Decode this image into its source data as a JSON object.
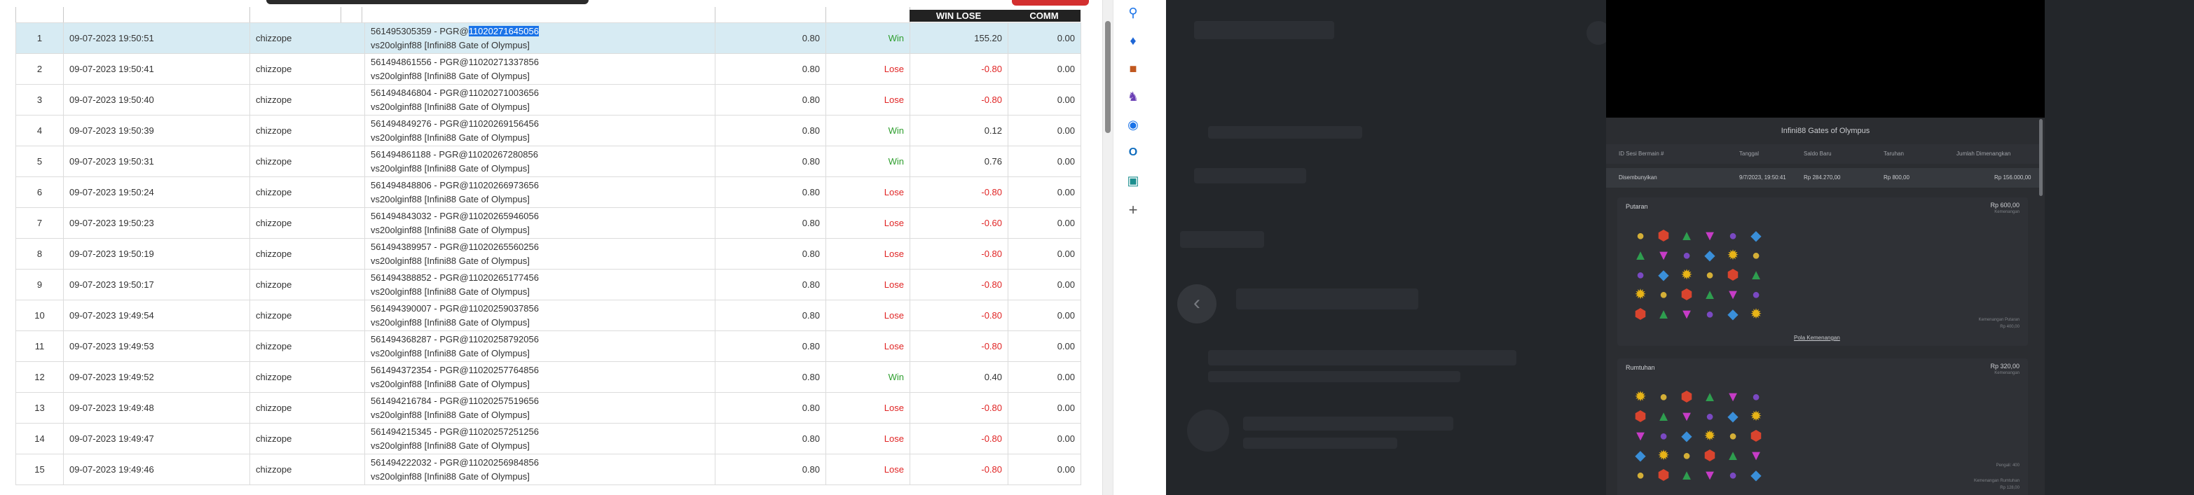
{
  "table": {
    "header_winlose": "WIN LOSE",
    "header_comm": "COMM",
    "rows": [
      {
        "no": "1",
        "datetime": "09-07-2023 19:50:51",
        "user": "chizzope",
        "ref_prefix": "561495305359 - PGR@",
        "ref_highlight": "11020271645056",
        "game": "vs20olginf88 [Infini88 Gate of Olympus]",
        "amount": "0.80",
        "result": "Win",
        "winlose": "155.20",
        "comm": "0.00"
      },
      {
        "no": "2",
        "datetime": "09-07-2023 19:50:41",
        "user": "chizzope",
        "ref_prefix": "561494861556 - PGR@11020271337856",
        "ref_highlight": "",
        "game": "vs20olginf88 [Infini88 Gate of Olympus]",
        "amount": "0.80",
        "result": "Lose",
        "winlose": "-0.80",
        "comm": "0.00"
      },
      {
        "no": "3",
        "datetime": "09-07-2023 19:50:40",
        "user": "chizzope",
        "ref_prefix": "561494846804 - PGR@11020271003656",
        "ref_highlight": "",
        "game": "vs20olginf88 [Infini88 Gate of Olympus]",
        "amount": "0.80",
        "result": "Lose",
        "winlose": "-0.80",
        "comm": "0.00"
      },
      {
        "no": "4",
        "datetime": "09-07-2023 19:50:39",
        "user": "chizzope",
        "ref_prefix": "561494849276 - PGR@11020269156456",
        "ref_highlight": "",
        "game": "vs20olginf88 [Infini88 Gate of Olympus]",
        "amount": "0.80",
        "result": "Win",
        "winlose": "0.12",
        "comm": "0.00"
      },
      {
        "no": "5",
        "datetime": "09-07-2023 19:50:31",
        "user": "chizzope",
        "ref_prefix": "561494861188 - PGR@11020267280856",
        "ref_highlight": "",
        "game": "vs20olginf88 [Infini88 Gate of Olympus]",
        "amount": "0.80",
        "result": "Win",
        "winlose": "0.76",
        "comm": "0.00"
      },
      {
        "no": "6",
        "datetime": "09-07-2023 19:50:24",
        "user": "chizzope",
        "ref_prefix": "561494848806 - PGR@11020266973656",
        "ref_highlight": "",
        "game": "vs20olginf88 [Infini88 Gate of Olympus]",
        "amount": "0.80",
        "result": "Lose",
        "winlose": "-0.80",
        "comm": "0.00"
      },
      {
        "no": "7",
        "datetime": "09-07-2023 19:50:23",
        "user": "chizzope",
        "ref_prefix": "561494843032 - PGR@11020265946056",
        "ref_highlight": "",
        "game": "vs20olginf88 [Infini88 Gate of Olympus]",
        "amount": "0.80",
        "result": "Lose",
        "winlose": "-0.60",
        "comm": "0.00"
      },
      {
        "no": "8",
        "datetime": "09-07-2023 19:50:19",
        "user": "chizzope",
        "ref_prefix": "561494389957 - PGR@11020265560256",
        "ref_highlight": "",
        "game": "vs20olginf88 [Infini88 Gate of Olympus]",
        "amount": "0.80",
        "result": "Lose",
        "winlose": "-0.80",
        "comm": "0.00"
      },
      {
        "no": "9",
        "datetime": "09-07-2023 19:50:17",
        "user": "chizzope",
        "ref_prefix": "561494388852 - PGR@11020265177456",
        "ref_highlight": "",
        "game": "vs20olginf88 [Infini88 Gate of Olympus]",
        "amount": "0.80",
        "result": "Lose",
        "winlose": "-0.80",
        "comm": "0.00"
      },
      {
        "no": "10",
        "datetime": "09-07-2023 19:49:54",
        "user": "chizzope",
        "ref_prefix": "561494390007 - PGR@11020259037856",
        "ref_highlight": "",
        "game": "vs20olginf88 [Infini88 Gate of Olympus]",
        "amount": "0.80",
        "result": "Lose",
        "winlose": "-0.80",
        "comm": "0.00"
      },
      {
        "no": "11",
        "datetime": "09-07-2023 19:49:53",
        "user": "chizzope",
        "ref_prefix": "561494368287 - PGR@11020258792056",
        "ref_highlight": "",
        "game": "vs20olginf88 [Infini88 Gate of Olympus]",
        "amount": "0.80",
        "result": "Lose",
        "winlose": "-0.80",
        "comm": "0.00"
      },
      {
        "no": "12",
        "datetime": "09-07-2023 19:49:52",
        "user": "chizzope",
        "ref_prefix": "561494372354 - PGR@11020257764856",
        "ref_highlight": "",
        "game": "vs20olginf88 [Infini88 Gate of Olympus]",
        "amount": "0.80",
        "result": "Win",
        "winlose": "0.40",
        "comm": "0.00"
      },
      {
        "no": "13",
        "datetime": "09-07-2023 19:49:48",
        "user": "chizzope",
        "ref_prefix": "561494216784 - PGR@11020257519656",
        "ref_highlight": "",
        "game": "vs20olginf88 [Infini88 Gate of Olympus]",
        "amount": "0.80",
        "result": "Lose",
        "winlose": "-0.80",
        "comm": "0.00"
      },
      {
        "no": "14",
        "datetime": "09-07-2023 19:49:47",
        "user": "chizzope",
        "ref_prefix": "561494215345 - PGR@11020257251256",
        "ref_highlight": "",
        "game": "vs20olginf88 [Infini88 Gate of Olympus]",
        "amount": "0.80",
        "result": "Lose",
        "winlose": "-0.80",
        "comm": "0.00"
      },
      {
        "no": "15",
        "datetime": "09-07-2023 19:49:46",
        "user": "chizzope",
        "ref_prefix": "561494222032 - PGR@11020256984856",
        "ref_highlight": "",
        "game": "vs20olginf88 [Infini88 Gate of Olympus]",
        "amount": "0.80",
        "result": "Lose",
        "winlose": "-0.80",
        "comm": "0.00"
      }
    ]
  },
  "sidebar_icons": [
    "search-icon",
    "tag-icon",
    "briefcase-icon",
    "chess-icon",
    "circle-app-icon",
    "outlook-icon",
    "cart-icon",
    "plus-icon"
  ],
  "modal": {
    "title": "Infini88 Gates of Olympus",
    "summary_headers": [
      "ID Sesi Bermain #",
      "Tanggal",
      "Saldo Baru",
      "Taruhan",
      "Jumlah Dimenangkan"
    ],
    "summary_values": [
      "Disembunyikan",
      "9/7/2023, 19:50:41",
      "Rp 284.270,00",
      "Rp 800,00",
      "Rp 156.000,00"
    ],
    "panel1": {
      "title": "Putaran",
      "amount": "Rp 600,00",
      "amount_sub": "Kemenangan",
      "note1": "Kemenangan Putaran",
      "note2": "Rp 400,00",
      "link": "Pola Kemenangan"
    },
    "panel2": {
      "title": "Rumtuhan",
      "amount": "Rp 320,00",
      "amount_sub": "Kemenangan",
      "note1": "Pengali: 400",
      "note2": "Kemenangan Rumtuhan",
      "note3": "Rp 128,00"
    }
  },
  "colors": {
    "win": "#2e9e2e",
    "lose": "#e02424",
    "selected_row": "#d7ebf3",
    "highlight": "#1a73e8"
  }
}
